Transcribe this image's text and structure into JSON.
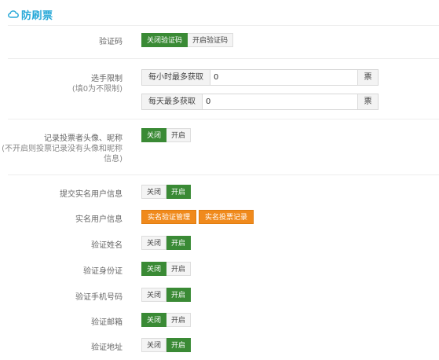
{
  "header": {
    "icon": "cloud-icon",
    "title": "防刷票",
    "accent": "#29a9d8"
  },
  "captcha": {
    "label": "验证码",
    "off": "关闭验证码",
    "on": "开启验证码"
  },
  "limit": {
    "label": "选手限制",
    "sublabel": "(填0为不限制)",
    "hourly_label": "每小时最多获取",
    "hourly_value": "0",
    "daily_label": "每天最多获取",
    "daily_value": "0",
    "unit": "票"
  },
  "record_avatar": {
    "label": "记录投票者头像、昵称",
    "sub1": "(不开启则投票记录没有头像和昵称",
    "sub2": "信息)",
    "off": "关闭",
    "on": "开启"
  },
  "submit_realname": {
    "label": "提交实名用户信息",
    "off": "关闭",
    "on": "开启"
  },
  "realname_info": {
    "label": "实名用户信息",
    "manage": "实名验证管理",
    "records": "实名投票记录"
  },
  "verify_name": {
    "label": "验证姓名",
    "off": "关闭",
    "on": "开启"
  },
  "verify_id": {
    "label": "验证身份证",
    "off": "关闭",
    "on": "开启"
  },
  "verify_phone": {
    "label": "验证手机号码",
    "off": "关闭",
    "on": "开启"
  },
  "verify_email": {
    "label": "验证邮箱",
    "off": "关闭",
    "on": "开启"
  },
  "verify_address": {
    "label": "验证地址",
    "off": "关闭",
    "on": "开启"
  },
  "colors": {
    "active_green": "#3a8a35",
    "orange": "#f08a1c"
  }
}
